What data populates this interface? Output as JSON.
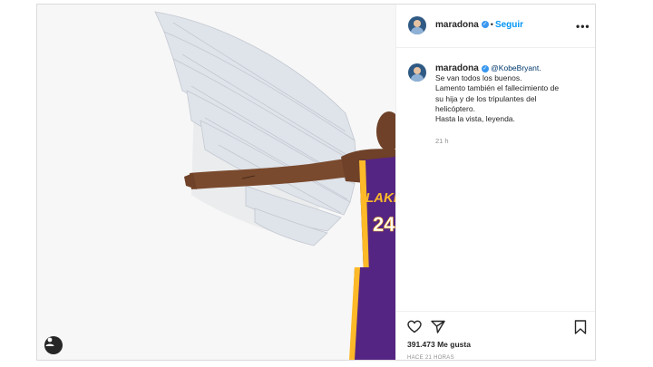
{
  "post": {
    "username": "maradona",
    "follow_label": "Seguir",
    "separator": "•",
    "more_icon": "•••",
    "caption": {
      "username": "maradona",
      "mention": "@KobeBryant.",
      "lines": [
        "Se van todos los buenos.",
        "Lamento también el fallecimiento de",
        "su hija y de los tripulantes del",
        "helicóptero.",
        "Hasta la vista, leyenda."
      ]
    },
    "time": "21 h",
    "likes": "391.473 Me gusta",
    "posted_ago": "HACE 21 HORAS",
    "jersey": {
      "team": "LAKERS",
      "number": "24"
    },
    "colors": {
      "follow": "#0095f6",
      "verified": "#3897f0",
      "lakers_purple": "#552583",
      "lakers_gold": "#fdb927"
    }
  }
}
